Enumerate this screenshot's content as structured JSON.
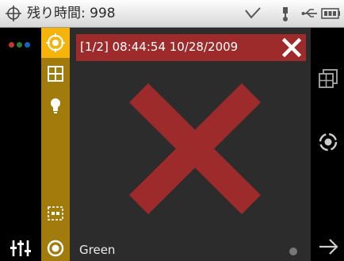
{
  "status_bar": {
    "title": "残り時間: 998",
    "icons": [
      "gps-icon",
      "signal-icon",
      "usb-plug-icon",
      "usb-icon",
      "battery-icon"
    ]
  },
  "left_column": {
    "dot_colors": [
      "#c0392b",
      "#2e7d32",
      "#1565c0"
    ],
    "icons": [
      "color-dots-icon",
      "equalizer-icon"
    ]
  },
  "gold_strip": {
    "icons": [
      "target-icon",
      "grid-icon",
      "lightbulb-icon",
      "frame-icon",
      "record-icon"
    ],
    "active_color": "#f6b30a",
    "color": "#a17c0c"
  },
  "header": {
    "text": "[1/2] 08:44:54 10/28/2009",
    "color": "#9d2b2b",
    "close_icon": "close-icon"
  },
  "main": {
    "mark_icon": "fail-x-icon",
    "mark_color": "#9d2b2b",
    "footer_label": "Green"
  },
  "right_column": {
    "icons": [
      "gallery-icon",
      "target-icon",
      "next-arrow-icon"
    ]
  }
}
